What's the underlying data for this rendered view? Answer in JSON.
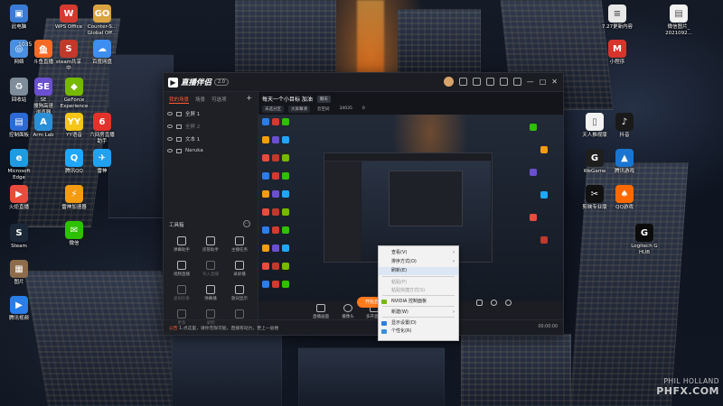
{
  "desktop": {
    "left_icons": [
      {
        "label": "此电脑",
        "color": "#3a7bd5",
        "glyph": "▣",
        "icon": "computer-icon"
      },
      {
        "label": "WPS Office",
        "color": "#d43a2f",
        "glyph": "W",
        "icon": "wps-icon"
      },
      {
        "label": "Counter-S...\nGlobal Off...",
        "color": "#d9a441",
        "glyph": "GO",
        "icon": "csgo-icon"
      },
      {
        "label": "网络",
        "color": "#4a90e2",
        "glyph": "◎",
        "icon": "network-icon"
      },
      {
        "label": "斗鱼直播",
        "color": "#f56a24",
        "glyph": "鱼",
        "icon": "douyu-icon"
      },
      {
        "label": "steam共享\n中",
        "color": "#c0392b",
        "glyph": "S",
        "icon": "steam-share-icon"
      },
      {
        "label": "百度网盘",
        "color": "#3d8ef0",
        "glyph": "☁",
        "icon": "baidu-pan-icon"
      },
      {
        "label": "回收站",
        "color": "#7f8c9a",
        "glyph": "♻",
        "icon": "recycle-bin-icon"
      },
      {
        "label": "SE\n搜狗高速\n浏览器",
        "color": "#6b4fd1",
        "glyph": "SE",
        "icon": "sogou-browser-icon"
      },
      {
        "label": "GeForce\nExperience",
        "color": "#76b900",
        "glyph": "◆",
        "icon": "geforce-icon"
      },
      {
        "label": "控制面板",
        "color": "#2d6ad4",
        "glyph": "▤",
        "icon": "control-panel-icon"
      },
      {
        "label": "Arm Lab",
        "color": "#2b8fd6",
        "glyph": "A",
        "icon": "armlab-icon"
      },
      {
        "label": "YY语音",
        "color": "#f5c518",
        "glyph": "YY",
        "icon": "yy-icon"
      },
      {
        "label": "六间房直播\n助手",
        "color": "#e4322b",
        "glyph": "6",
        "icon": "6room-icon"
      },
      {
        "label": "Microsoft\nEdge",
        "color": "#1f9be0",
        "glyph": "e",
        "icon": "edge-icon"
      },
      {
        "label": "腾讯QQ",
        "color": "#1ea7fd",
        "glyph": "Q",
        "icon": "qq-icon"
      },
      {
        "label": "雷神",
        "color": "#21a1f1",
        "glyph": "✈",
        "icon": "leishen-icon"
      },
      {
        "label": "火炬直播",
        "color": "#e74c3c",
        "glyph": "▶",
        "icon": "live-icon"
      },
      {
        "label": "雷神加速器",
        "color": "#f39c12",
        "glyph": "⚡",
        "icon": "accelerator-icon"
      },
      {
        "label": "微信",
        "color": "#2dc100",
        "glyph": "✉",
        "icon": "wechat-icon"
      },
      {
        "label": "Steam",
        "color": "#1b2838",
        "glyph": "S",
        "icon": "steam-icon"
      },
      {
        "label": "图片",
        "color": "#8e6b4a",
        "glyph": "▦",
        "icon": "picture-icon"
      },
      {
        "label": "腾讯视频",
        "color": "#2b7de9",
        "glyph": "▶",
        "icon": "video-icon"
      }
    ],
    "right_icons": [
      {
        "label": "7.27更新内容",
        "color": "#e8e8e8",
        "glyph": "≡",
        "icon": "document-icon"
      },
      {
        "label": "微信图片_\n2021092...",
        "color": "#f2f2f2",
        "glyph": "▤",
        "icon": "image-file-icon"
      },
      {
        "label": "小程序",
        "color": "#d9342b",
        "glyph": "M",
        "icon": "app-icon"
      },
      {
        "label": "天人推视版",
        "color": "#f2f2f2",
        "glyph": "▯",
        "icon": "file-icon"
      },
      {
        "label": "抖音",
        "color": "#1a1a1a",
        "glyph": "♪",
        "icon": "douyin-icon"
      },
      {
        "label": "WeGame",
        "color": "#1e1e1e",
        "glyph": "G",
        "icon": "wegame-icon"
      },
      {
        "label": "腾讯游戏",
        "color": "#1a75d2",
        "glyph": "▲",
        "icon": "tencent-games-icon"
      },
      {
        "label": "剪映专业版",
        "color": "#111111",
        "glyph": "✂",
        "icon": "capcut-icon"
      },
      {
        "label": "QQ游戏",
        "color": "#ff6a00",
        "glyph": "♠",
        "icon": "qq-game-icon"
      },
      {
        "label": "Logitech G\nHUB",
        "color": "#0b0b0b",
        "glyph": "G",
        "icon": "logitech-icon"
      }
    ],
    "badge_number": "1035"
  },
  "app": {
    "name": "直播伴侣",
    "version": "2.0",
    "scene_tabs": [
      "我的场景",
      "场景",
      "可选项"
    ],
    "sources": [
      {
        "name": "全屏 1",
        "dim": false
      },
      {
        "name": "全屏 2",
        "dim": true
      },
      {
        "name": "文本 1",
        "dim": false
      },
      {
        "name": "Naruka",
        "dim": false
      }
    ],
    "tools_title": "工具箱",
    "tools": [
      {
        "label": "弹幕助手",
        "dim": false
      },
      {
        "label": "房管助手",
        "dim": false
      },
      {
        "label": "主播任务",
        "dim": false
      },
      {
        "label": "视频直播",
        "dim": false
      },
      {
        "label": "导入直播",
        "dim": true
      },
      {
        "label": "录屏播",
        "dim": false
      },
      {
        "label": "虚拟形象",
        "dim": true
      },
      {
        "label": "弹幕播",
        "dim": false
      },
      {
        "label": "歌词显示",
        "dim": false
      },
      {
        "label": "更多",
        "dim": true
      },
      {
        "label": "录制",
        "dim": true
      },
      {
        "label": "",
        "dim": true
      }
    ],
    "preview": {
      "title": "每天一个小目标 加油",
      "badge": "聊天",
      "meta": [
        "未选分区",
        "大屏幕清",
        "云空间",
        "34035"
      ],
      "count": "0"
    },
    "bottom_controls": [
      "直播画面",
      "摄像头",
      "多开直播"
    ],
    "go_live": "开始直播",
    "status_msg": "1.点这里，请你无限可能，直播有动力，更上一层楼",
    "status_highlight": "公告",
    "status_time": "00:00:00"
  },
  "context_menu": {
    "items": [
      {
        "label": "查看(V)",
        "arrow": true,
        "hl": false,
        "dim": false
      },
      {
        "label": "排序方式(O)",
        "arrow": true,
        "hl": false,
        "dim": false
      },
      {
        "label": "刷新(E)",
        "arrow": false,
        "hl": true,
        "dim": false
      },
      {
        "label": "粘贴(P)",
        "arrow": false,
        "hl": false,
        "dim": true
      },
      {
        "label": "粘贴快捷方式(S)",
        "arrow": false,
        "hl": false,
        "dim": true
      },
      {
        "label": "NVIDIA 控制面板",
        "arrow": false,
        "hl": false,
        "dim": false,
        "icon": "nvidia-icon",
        "icon_color": "#76b900"
      },
      {
        "label": "新建(W)",
        "arrow": true,
        "hl": false,
        "dim": false
      },
      {
        "label": "显示设置(D)",
        "arrow": false,
        "hl": false,
        "dim": false,
        "icon": "display-icon",
        "icon_color": "#2f7de1"
      },
      {
        "label": "个性化(R)",
        "arrow": false,
        "hl": false,
        "dim": false,
        "icon": "personalize-icon",
        "icon_color": "#3a8edb"
      }
    ]
  },
  "watermark": {
    "line1": "PHIL HOLLAND",
    "line2": "PHFX.COM"
  }
}
